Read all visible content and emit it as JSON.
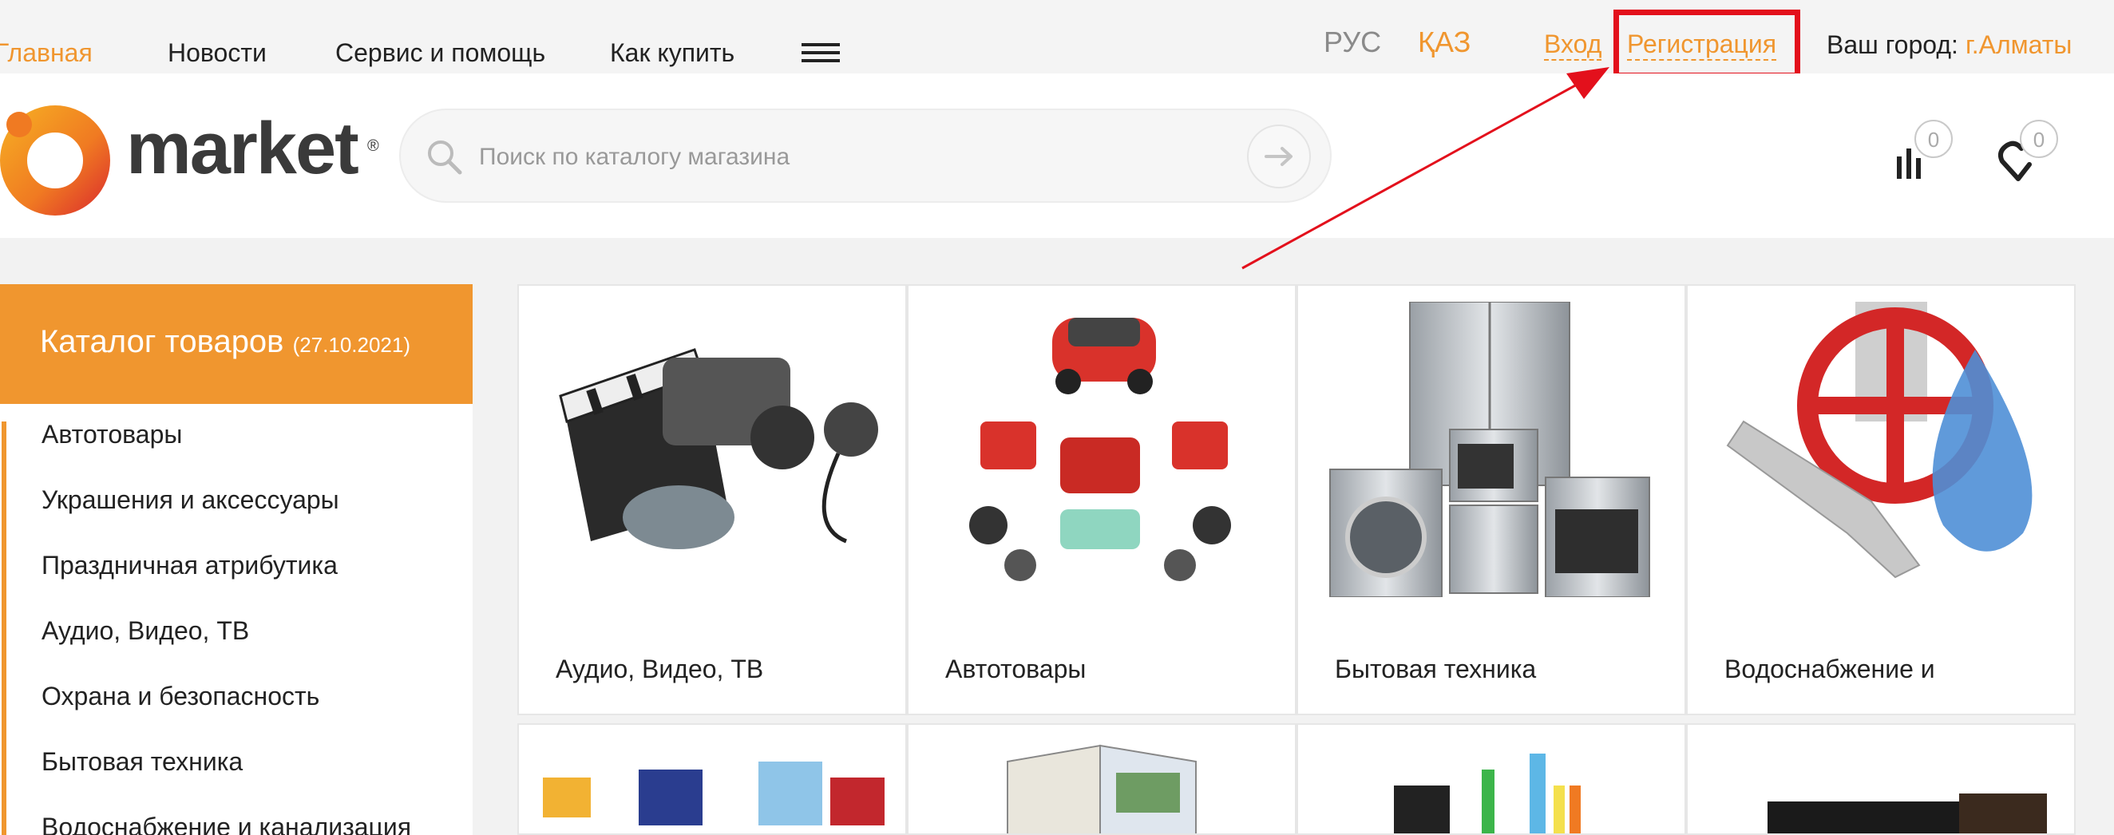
{
  "colors": {
    "accent": "#f0962f",
    "highlight": "#e3101c",
    "text": "#222222",
    "muted": "#8a8a8a"
  },
  "topnav": {
    "items": [
      "Главная",
      "Новости",
      "Сервис и помощь",
      "Как купить"
    ],
    "menu_icon": "hamburger-menu-icon",
    "lang_ru": "РУС",
    "lang_kz": "ҚАЗ",
    "login": "Вход",
    "register": "Регистрация",
    "city_label": "Ваш город:",
    "city": "г.Алматы"
  },
  "header": {
    "logo_text": "market",
    "logo_reg": "®",
    "search_placeholder": "Поиск по каталогу магазина",
    "search_icon": "search-icon",
    "search_go_icon": "arrow-right-icon",
    "compare_icon": "compare-bars-icon",
    "compare_count": "0",
    "favorites_icon": "heart-icon",
    "favorites_count": "0"
  },
  "catalog": {
    "title": "Каталог товаров",
    "date": "(27.10.2021)",
    "items": [
      "Автотовары",
      "Украшения и аксессуары",
      "Праздничная атрибутика",
      "Аудио, Видео, ТВ",
      "Охрана и безопасность",
      "Бытовая техника",
      "Водоснабжение и канализация"
    ]
  },
  "products": [
    {
      "label": "Аудио, Видео, ТВ",
      "image": "video-camera-clapperboard-image"
    },
    {
      "label": "Автотовары",
      "image": "car-parts-image"
    },
    {
      "label": "Бытовая техника",
      "image": "home-appliances-image"
    },
    {
      "label": "Водоснабжение и",
      "image": "water-valve-image"
    }
  ],
  "products_row2": [
    {
      "image": "baby-furniture-image"
    },
    {
      "image": "book-image"
    },
    {
      "image": "stationery-image"
    },
    {
      "image": "monitor-image"
    }
  ]
}
